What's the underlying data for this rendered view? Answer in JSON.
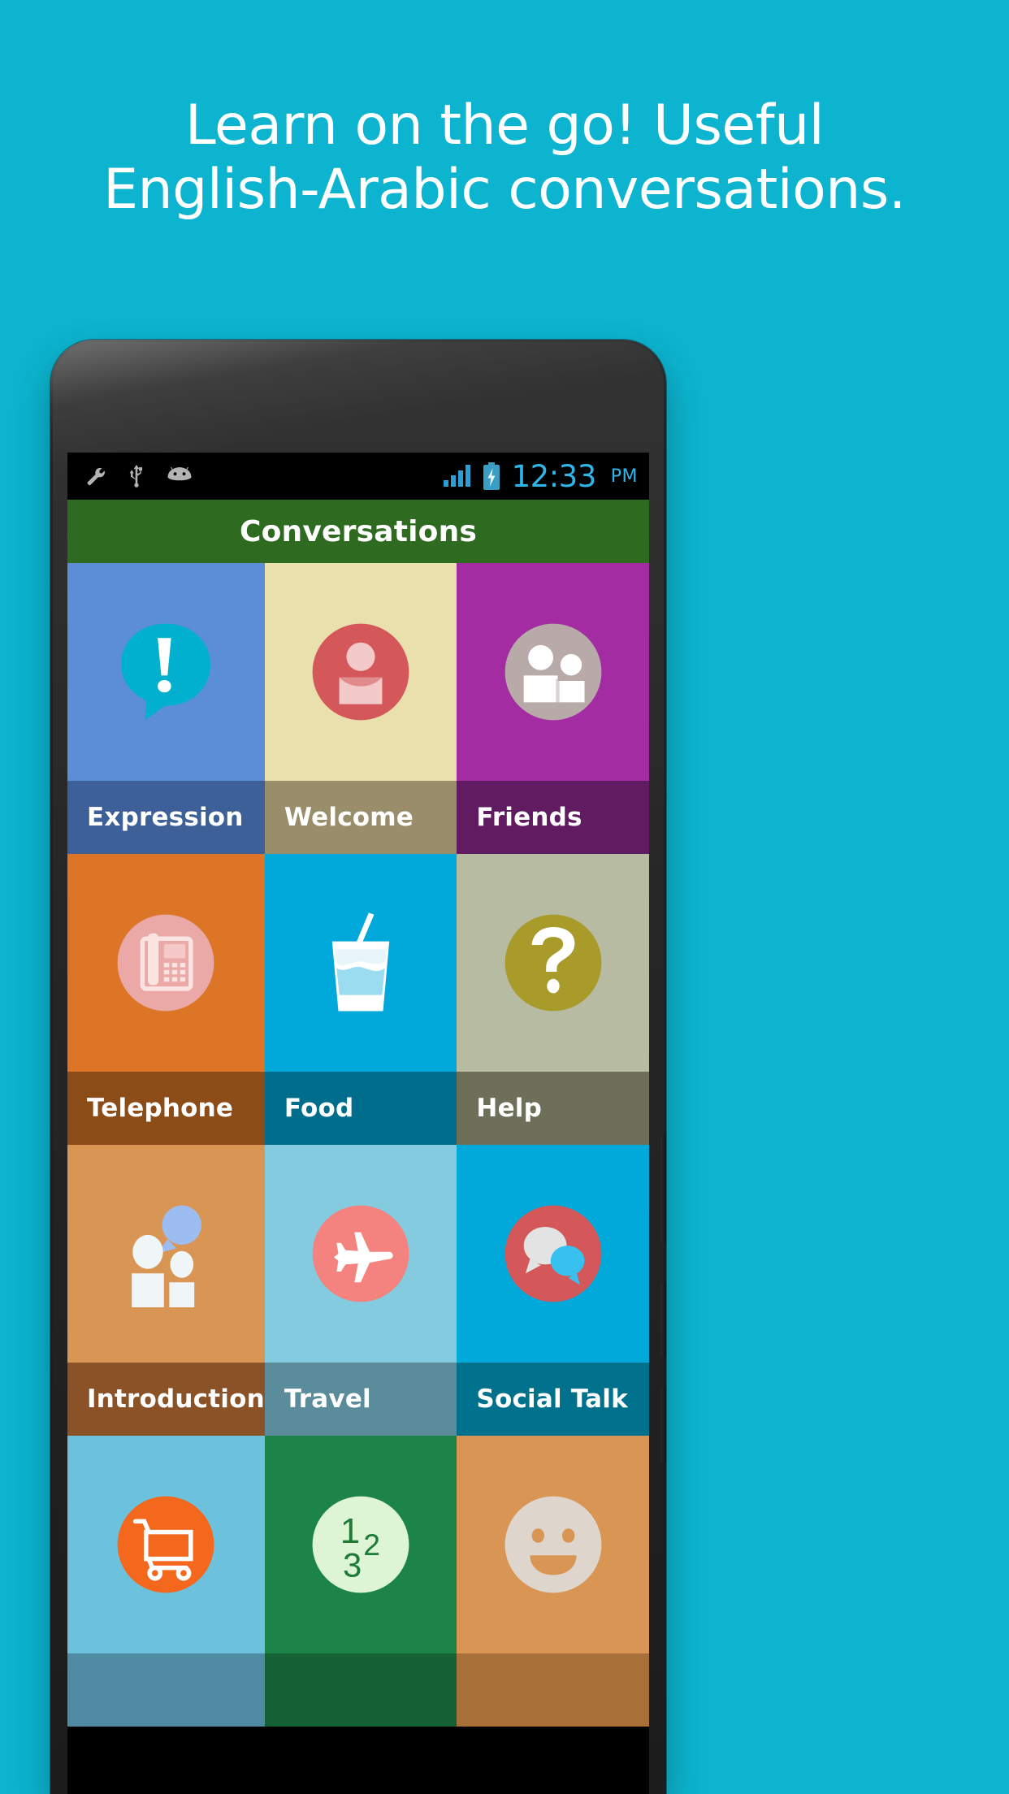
{
  "background_color": "#0cb4cf",
  "headline": {
    "line1": "Learn on the go! Useful",
    "line2": "English-Arabic conversations.",
    "color": "#ffffff"
  },
  "phone": {
    "camera_label": "front-camera",
    "speaker_label": "earpiece-speaker"
  },
  "statusbar": {
    "background": "#000000",
    "left_icons": [
      "wrench-icon",
      "usb-icon",
      "android-icon"
    ],
    "right_icons": [
      "signal-bars-icon",
      "battery-charging-icon"
    ],
    "time": "12:33",
    "ampm": "PM",
    "accent_color": "#2fb6e8"
  },
  "actionbar": {
    "title": "Conversations",
    "background": "#2e6b20",
    "text_color": "#ffffff"
  },
  "grid": {
    "tiles": [
      {
        "label": "Expression",
        "icon": "speech-bubble-exclamation-icon",
        "icon_bg": "#00b0ce",
        "icon_fg": "#ffffff",
        "tile_bg": "#5b8ed6",
        "label_bg": "#3d6099"
      },
      {
        "label": "Welcome",
        "icon": "person-circle-icon",
        "icon_bg": "#d4585a",
        "icon_fg": "#f4c9c9",
        "tile_bg": "#e9e0ae",
        "label_bg": "#9a8e6a"
      },
      {
        "label": "Friends",
        "icon": "two-people-circle-icon",
        "icon_bg": "#b8aaa8",
        "icon_fg": "#ffffff",
        "tile_bg": "#a32ca3",
        "label_bg": "#611b61"
      },
      {
        "label": "Telephone",
        "icon": "desk-phone-circle-icon",
        "icon_bg": "#eaa9a6",
        "icon_fg": "#fbe3e2",
        "tile_bg": "#dd7527",
        "label_bg": "#8c4c17"
      },
      {
        "label": "Food",
        "icon": "drink-cup-straw-icon",
        "icon_bg": "transparent",
        "icon_fg": "#ffffff",
        "tile_bg": "#00a9da",
        "label_bg": "#006d8c"
      },
      {
        "label": "Help",
        "icon": "question-mark-circle-icon",
        "icon_bg": "#a89b2a",
        "icon_fg": "#ffffff",
        "tile_bg": "#b6bba2",
        "label_bg": "#6d6f58"
      },
      {
        "label": "Introduction",
        "icon": "two-people-speech-bubble-icon",
        "icon_bg": "transparent",
        "icon_fg": "#f0f6f8",
        "tile_bg": "#d99553",
        "label_bg": "#8a5226"
      },
      {
        "label": "Travel",
        "icon": "airplane-circle-icon",
        "icon_bg": "#f4837f",
        "icon_fg": "#ffffff",
        "tile_bg": "#84cbe0",
        "label_bg": "#5b8c9c"
      },
      {
        "label": "Social Talk",
        "icon": "chat-bubbles-circle-icon",
        "icon_bg": "#d4585a",
        "icon_fg": "#e3e3e3",
        "tile_bg": "#00a9da",
        "label_bg": "#00718d"
      },
      {
        "label": "",
        "icon": "shopping-cart-circle-icon",
        "icon_bg": "#f4681d",
        "icon_fg": "#ffffff",
        "tile_bg": "#6cc2dd",
        "label_bg": "#4f8ba3"
      },
      {
        "label": "",
        "icon": "numbers-123-circle-icon",
        "icon_bg": "#ddf5d4",
        "icon_fg": "#1d7a37",
        "tile_bg": "#1d8449",
        "label_bg": "#156034"
      },
      {
        "label": "",
        "icon": "smiley-face-circle-icon",
        "icon_bg": "#ded5cd",
        "icon_fg": "#d99553",
        "tile_bg": "#d99553",
        "label_bg": "#a86f38"
      }
    ]
  }
}
